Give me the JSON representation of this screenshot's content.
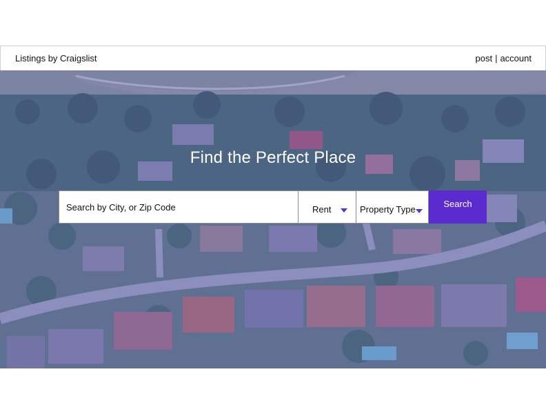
{
  "header": {
    "brand": "Listings by Craigslist",
    "nav": {
      "post_label": "post",
      "separator": "|",
      "account_label": "account"
    }
  },
  "hero": {
    "title": "Find the Perfect Place",
    "background": "aerial-suburban-neighborhood-photo",
    "overlay_color": "#605cbe"
  },
  "search": {
    "placeholder": "Search by City, or Zip Code",
    "value": "",
    "listing_type": {
      "selected": "Rent"
    },
    "property_type": {
      "selected": "Property Type"
    },
    "button_label": "Search",
    "accent_color": "#5b2bd0"
  }
}
